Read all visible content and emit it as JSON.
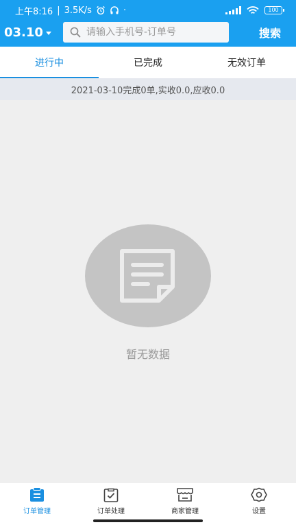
{
  "status_bar": {
    "time": "上午8:16",
    "speed": "3.5K/s",
    "separator": "|",
    "dot": "·",
    "battery": "100"
  },
  "toolbar": {
    "date": "03.10",
    "search_placeholder": "请输入手机号-订单号",
    "search_label": "搜索"
  },
  "tabs": [
    {
      "label": "进行中",
      "active": true
    },
    {
      "label": "已完成",
      "active": false
    },
    {
      "label": "无效订单",
      "active": false
    }
  ],
  "summary": "2021-03-10完成0单,实收0.0,应收0.0",
  "empty": {
    "text": "暂无数据"
  },
  "bottom_nav": [
    {
      "label": "订单管理",
      "icon": "clipboard-icon",
      "active": true
    },
    {
      "label": "订单处理",
      "icon": "clipboard-check-icon",
      "active": false
    },
    {
      "label": "商家管理",
      "icon": "store-icon",
      "active": false
    },
    {
      "label": "设置",
      "icon": "gear-icon",
      "active": false
    }
  ],
  "colors": {
    "primary": "#1aa0f0",
    "active_tab": "#1a8fe0",
    "background": "#efefef"
  }
}
